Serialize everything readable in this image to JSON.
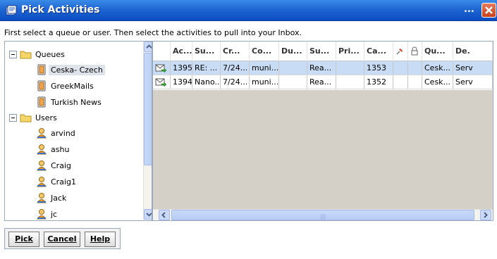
{
  "window": {
    "title": "Pick Activities",
    "overflow_dots": "..."
  },
  "instruction": "First select a queue or user. Then select the activities to pull into your Inbox.",
  "tree": {
    "queues_label": "Queues",
    "queues": [
      "Ceska- Czech",
      "GreekMails",
      "Turkish News"
    ],
    "users_label": "Users",
    "users": [
      "arvind",
      "ashu",
      "Craig",
      "Craig1",
      "Jack",
      "jc"
    ]
  },
  "grid": {
    "columns": [
      "",
      "Ac...▽",
      "Su...",
      "Cr...",
      "Co...",
      "Du...",
      "Su...",
      "Pri...",
      "Ca...",
      "",
      "",
      "Qu...",
      "De."
    ],
    "column_icons": [
      "pin-icon",
      "lock-icon"
    ],
    "rows": [
      [
        "",
        "1395",
        "RE: ...",
        "7/24...",
        "muni...",
        "",
        "Rea...",
        "",
        "1353",
        "",
        "",
        "Cesk...",
        "Serv"
      ],
      [
        "",
        "1394",
        "Nano...",
        "7/24...",
        "muni...",
        "",
        "Rea...",
        "",
        "1352",
        "",
        "",
        "Cesk...",
        "Serv"
      ]
    ],
    "selected_row": 0
  },
  "buttons": {
    "pick": "Pick",
    "cancel": "Cancel",
    "help": "Help"
  },
  "colors": {
    "titlebar": "#1f66d4",
    "selection": "#c9dcf5"
  }
}
